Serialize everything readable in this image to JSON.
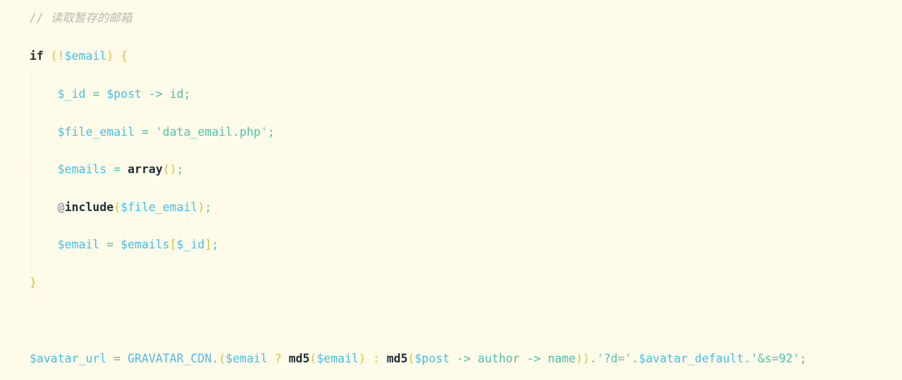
{
  "editor": {
    "background_color": "#fffbe9",
    "language": "php",
    "font_size_px": 16.5,
    "indent_guide_color": "#e2dcc2"
  },
  "palette": {
    "comment": "#b5b8ae",
    "keyword": "#242f38",
    "function": "#1f2d3a",
    "variable": "#41bfe8",
    "constant": "#55b9e6",
    "operator": "#4dbfa8",
    "punctuation": "#d8c13f",
    "string": "#4dc4ae",
    "at_sign": "#9aa0a6"
  },
  "code": {
    "line_1_comment_slashes": "// ",
    "line_1_comment_text": "读取暂存的邮箱",
    "line_2_if": "if",
    "line_2_space": " ",
    "line_2_paren_open": "(",
    "line_2_bang": "!",
    "line_2_var": "$email",
    "line_2_paren_close": ")",
    "line_2_brace": " {",
    "line_3_indent": "    ",
    "line_3_var": "$_id",
    "line_3_eq": " = ",
    "line_3_post": "$post",
    "line_3_arrow": " -> ",
    "line_3_prop": "id",
    "line_3_semi": ";",
    "line_4_indent": "    ",
    "line_4_var": "$file_email",
    "line_4_eq": " = ",
    "line_4_string": "'data_email.php'",
    "line_4_semi": ";",
    "line_5_indent": "    ",
    "line_5_var": "$emails",
    "line_5_eq": " = ",
    "line_5_func": "array",
    "line_5_parens": "()",
    "line_5_semi": ";",
    "line_6_indent": "    ",
    "line_6_at": "@",
    "line_6_func": "include",
    "line_6_paren_open": "(",
    "line_6_var": "$file_email",
    "line_6_paren_close": ")",
    "line_6_semi": ";",
    "line_7_indent": "    ",
    "line_7_var": "$email",
    "line_7_eq": " = ",
    "line_7_arr": "$emails",
    "line_7_bracket_open": "[",
    "line_7_key": "$_id",
    "line_7_bracket_close": "]",
    "line_7_semi": ";",
    "line_8_closing_brace": "}",
    "line_11_var": "$avatar_url",
    "line_11_eq": " = ",
    "line_11_const": "GRAVATAR_CDN",
    "line_11_dot1": ".",
    "line_11_paren1": "(",
    "line_11_var2": "$email",
    "line_11_question": " ? ",
    "line_11_md5a": "md5",
    "line_11_paren2": "(",
    "line_11_var3": "$email",
    "line_11_paren3": ")",
    "line_11_colon": " : ",
    "line_11_md5b": "md5",
    "line_11_paren4": "(",
    "line_11_post": "$post",
    "line_11_arrow1": " -> ",
    "line_11_author": "author",
    "line_11_arrow2": " -> ",
    "line_11_name": "name",
    "line_11_parens_close": "))",
    "line_11_dot2": ".",
    "line_11_str1": "'?d='",
    "line_11_dot3": ".",
    "line_11_var4": "$avatar_default",
    "line_11_dot4": ".",
    "line_11_str2": "'&s=92'",
    "line_11_semi": ";"
  }
}
